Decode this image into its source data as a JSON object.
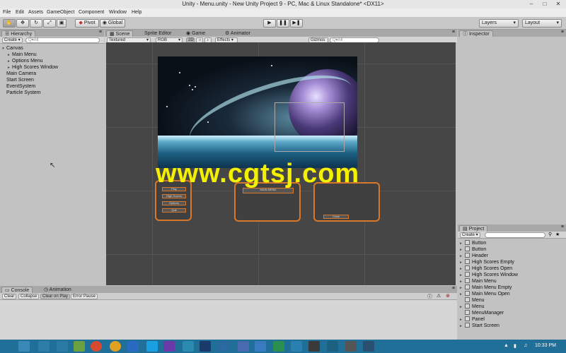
{
  "window": {
    "title": "Unity - Menu.unity - New Unity Project 9 - PC, Mac & Linux Standalone* <DX11>"
  },
  "menubar": [
    "File",
    "Edit",
    "Assets",
    "GameObject",
    "Component",
    "Window",
    "Help"
  ],
  "toolbar": {
    "pivot_label": "Pivot",
    "global_label": "Global",
    "layers_label": "Layers",
    "layout_label": "Layout"
  },
  "hierarchy": {
    "tab_label": "Hierarchy",
    "create_label": "Create",
    "search_placeholder": "Q▾All",
    "items": [
      {
        "label": "Canvas",
        "indent": 0,
        "arrow": "▼"
      },
      {
        "label": "Main Menu",
        "indent": 1,
        "arrow": "►"
      },
      {
        "label": "Options Menu",
        "indent": 1,
        "arrow": "►"
      },
      {
        "label": "High Scores Window",
        "indent": 1,
        "arrow": "►"
      },
      {
        "label": "Main Camera",
        "indent": 0,
        "arrow": ""
      },
      {
        "label": "Start Screen",
        "indent": 0,
        "arrow": ""
      },
      {
        "label": "EventSystem",
        "indent": 0,
        "arrow": ""
      },
      {
        "label": "Particle System",
        "indent": 0,
        "arrow": ""
      }
    ]
  },
  "scene": {
    "tabs": [
      "Scene",
      "Sprite Editor",
      "Game",
      "Animator"
    ],
    "active_tab": "Scene",
    "shading": "Textured",
    "render": "RGB",
    "mode_2d": "2D",
    "effects": "Effects",
    "gizmos": "Gizmos",
    "search_placeholder": "Q▾All",
    "ui_panels": {
      "left_buttons": [
        "Play",
        "High Scores",
        "Options",
        "Quit"
      ],
      "middle_label": "MAIN MENU",
      "right_button": "Close"
    }
  },
  "watermark": "www.cgtsj.com",
  "inspector": {
    "tab_label": "Inspector"
  },
  "project": {
    "tab_label": "Project",
    "create_label": "Create",
    "items": [
      {
        "label": "Button",
        "arrow": "►",
        "icon": "prefab-icon"
      },
      {
        "label": "Button",
        "arrow": "►",
        "icon": "prefab-icon"
      },
      {
        "label": "Header",
        "arrow": "►",
        "icon": "prefab-icon"
      },
      {
        "label": "High Scores Empty",
        "arrow": "►",
        "icon": "prefab-icon"
      },
      {
        "label": "High Scores Open",
        "arrow": "►",
        "icon": "prefab-icon"
      },
      {
        "label": "High Scores Window",
        "arrow": "►",
        "icon": "prefab-icon"
      },
      {
        "label": "Main Menu",
        "arrow": "►",
        "icon": "prefab-icon"
      },
      {
        "label": "Main Menu Empty",
        "arrow": "►",
        "icon": "prefab-icon"
      },
      {
        "label": "Main Menu Open",
        "arrow": "►",
        "icon": "prefab-icon"
      },
      {
        "label": "Menu",
        "arrow": "",
        "icon": "animator-icon"
      },
      {
        "label": "Menu",
        "arrow": "►",
        "icon": "prefab-icon"
      },
      {
        "label": "MenuManager",
        "arrow": "",
        "icon": "script-icon"
      },
      {
        "label": "Panel",
        "arrow": "►",
        "icon": "prefab-icon"
      },
      {
        "label": "Start Screen",
        "arrow": "►",
        "icon": "prefab-icon"
      }
    ]
  },
  "console": {
    "tabs": [
      "Console",
      "Animation"
    ],
    "buttons": [
      "Clear",
      "Collapse",
      "Clear on Play",
      "Error Pause"
    ]
  },
  "taskbar": {
    "clock": "10:33 PM"
  },
  "colors": {
    "panel": "#c2c2c2",
    "viewport": "#464646",
    "watermark": "#f3f000",
    "ui_orange": "#d9782a",
    "taskbar": "#1f6f98"
  }
}
